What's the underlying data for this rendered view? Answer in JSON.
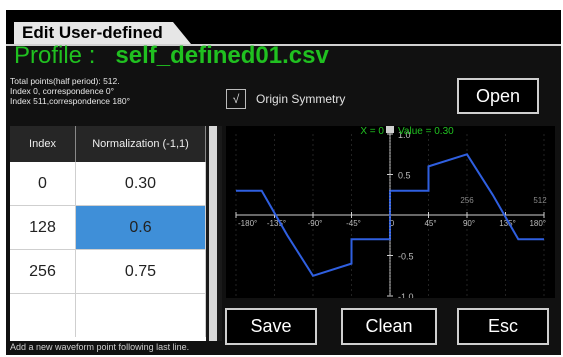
{
  "window": {
    "title": "Edit User-defined"
  },
  "profile": {
    "label": "Profile :",
    "filename": "self_defined01.csv"
  },
  "info": {
    "line1": "Total points(half period): 512.",
    "line2": "Index 0, correspondence 0°",
    "line3": "Index 511,correspondence 180°"
  },
  "origin_symmetry": {
    "mark": "√",
    "label": "Origin Symmetry",
    "checked": true
  },
  "buttons": {
    "open": "Open",
    "save": "Save",
    "clean": "Clean",
    "esc": "Esc"
  },
  "table": {
    "headers": [
      "Index",
      "Normalization  (-1,1)"
    ],
    "rows": [
      {
        "index": "0",
        "value": "0.30",
        "selected": false
      },
      {
        "index": "128",
        "value": "0.6",
        "selected": true
      },
      {
        "index": "256",
        "value": "0.75",
        "selected": false
      }
    ]
  },
  "status": "Add a new waveform point following last line.",
  "plot": {
    "cursor_readout": "X = 0",
    "value_readout": "Value = 0.30",
    "colors": {
      "waveform": "#2f5fe0",
      "readout": "#20c020",
      "axis": "#cfcfcf",
      "grid": "#3a3a3a"
    }
  },
  "chart_data": {
    "type": "line",
    "x_tick_labels": [
      "-180°",
      "-135°",
      "-90°",
      "-45°",
      "0",
      "45°",
      "90°",
      "135°",
      "180°"
    ],
    "y_tick_labels": [
      "1.0",
      "0.5",
      "-0.5",
      "-1.0"
    ],
    "top_tick_labels": [
      "256",
      "512"
    ],
    "xlim": [
      -180,
      180
    ],
    "ylim": [
      -1,
      1
    ],
    "series": [
      {
        "x": [
          -180,
          -150,
          -120,
          -90,
          -45,
          -45,
          0,
          0,
          45,
          45,
          90,
          120,
          150,
          180
        ],
        "y": [
          0.3,
          0.3,
          -0.25,
          -0.75,
          -0.6,
          -0.3,
          -0.3,
          0.3,
          0.3,
          0.6,
          0.75,
          0.25,
          -0.3,
          -0.3
        ]
      }
    ]
  }
}
